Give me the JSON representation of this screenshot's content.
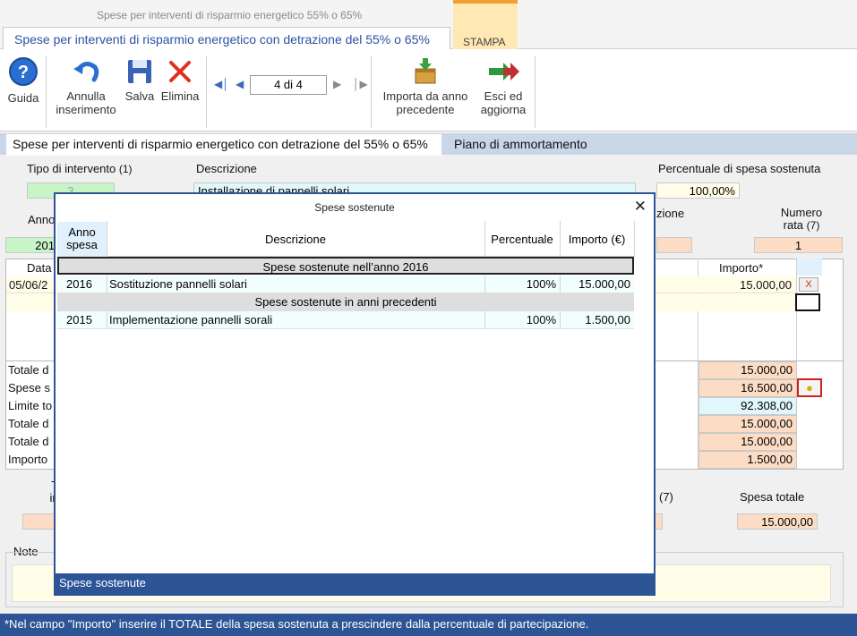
{
  "window": {
    "title": "Spese per interventi di risparmio energetico 55% o 65%"
  },
  "ribbon_tabs": {
    "main": "Spese per interventi di risparmio energetico con detrazione del 55% o 65%",
    "stampa": "STAMPA"
  },
  "toolbar": {
    "guida": "Guida",
    "annulla_1": "Annulla",
    "annulla_2": "inserimento",
    "salva": "Salva",
    "elimina": "Elimina",
    "record_nav": "4 di 4",
    "importa_1": "Importa da anno",
    "importa_2": "precedente",
    "esci_1": "Esci ed",
    "esci_2": "aggiorna"
  },
  "section_tabs": {
    "tab1": "Spese per interventi di risparmio energetico con detrazione del 55% o 65%",
    "tab2": "Piano di ammortamento"
  },
  "form": {
    "tipo_label": "Tipo di intervento",
    "tipo_note": "(1)",
    "tipo_value": "3",
    "descrizione_label": "Descrizione",
    "descrizione_value": "Installazione di pannelli solari",
    "percentuale_label": "Percentuale di spesa sostenuta",
    "percentuale_value": "100,00%",
    "anno_label": "Anno",
    "anno_value": "201",
    "zione_label": "zione",
    "numero_rata_label_1": "Numero",
    "numero_rata_label_2": "rata",
    "numero_rata_note": "(7)",
    "numero_rata_value": "1",
    "grid_data_header": "Data",
    "grid_importo_header": "Importo*",
    "grid_row_date": "05/06/2",
    "grid_row_importo": "15.000,00",
    "delete_x": "X",
    "totali": [
      {
        "label": "Totale d",
        "value": "15.000,00"
      },
      {
        "label": "Spese s",
        "value": "16.500,00"
      },
      {
        "label": "Limite to",
        "value": "92.308,00"
      },
      {
        "label": "Totale d",
        "value": "15.000,00"
      },
      {
        "label": "Totale d",
        "value": "15.000,00"
      },
      {
        "label": "Importo",
        "value": "1.500,00"
      }
    ],
    "tip_label_1": "Tip",
    "tip_label_2": "inte",
    "seven_label": "(7)",
    "spesa_totale_label": "Spesa totale",
    "spesa_totale_value": "15.000,00",
    "note_label": "Note"
  },
  "modal": {
    "title": "Spese sostenute",
    "col_anno_1": "Anno",
    "col_anno_2": "spesa",
    "col_descrizione": "Descrizione",
    "col_percentuale": "Percentuale",
    "col_importo": "Importo (€)",
    "group1": "Spese sostenute nell’anno 2016",
    "row1": {
      "anno": "2016",
      "descrizione": "Sostituzione pannelli solari",
      "percentuale": "100%",
      "importo": "15.000,00"
    },
    "group2": "Spese sostenute in anni precedenti",
    "row2": {
      "anno": "2015",
      "descrizione": "Implementazione pannelli sorali",
      "percentuale": "100%",
      "importo": "1.500,00"
    },
    "footer": "Spese sostenute"
  },
  "footer_note": "*Nel campo \"Importo\" inserire il TOTALE della spesa sostenuta a prescindere dalla percentuale di partecipazione.",
  "colors": {
    "accent_blue": "#2d5596",
    "peach": "#fcdcc4",
    "green": "#c8f5c8",
    "stampa_tab": "#ffe8b4"
  }
}
